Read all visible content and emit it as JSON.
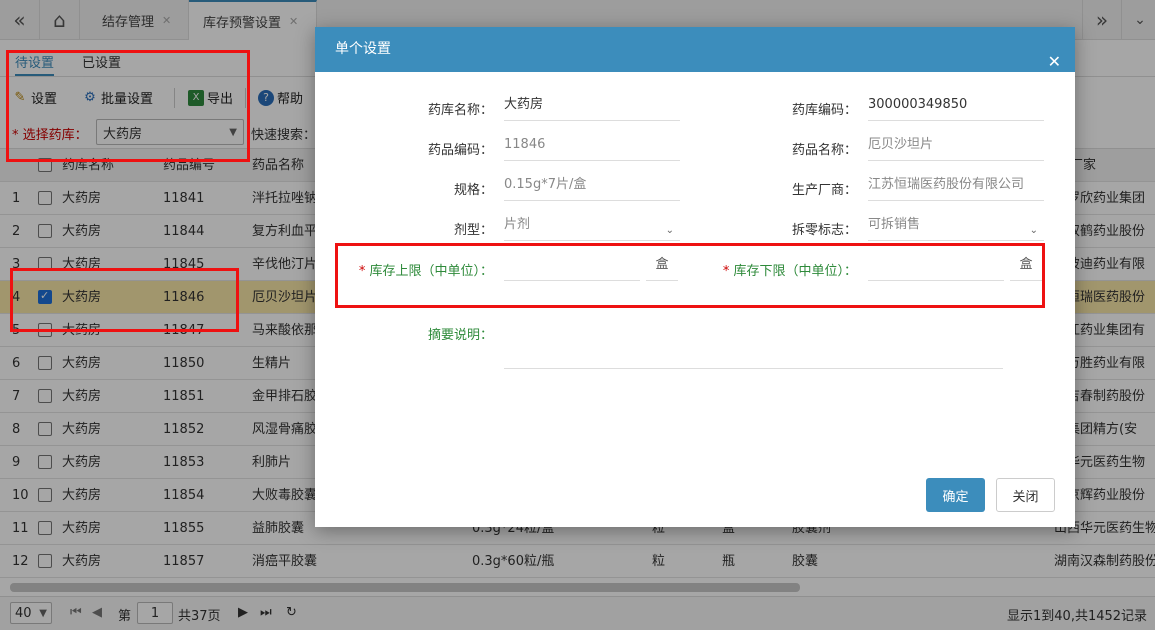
{
  "topbar": {
    "tabs": [
      {
        "label": "结存管理"
      },
      {
        "label": "库存预警设置"
      }
    ]
  },
  "subtabs": [
    "待设置",
    "已设置"
  ],
  "toolbar": {
    "set": "设置",
    "batch": "批量设置",
    "export": "导出",
    "help": "帮助"
  },
  "filter": {
    "warehouse_label": "选择药库：",
    "warehouse_value": "大药房",
    "quick_search_label": "快速搜索："
  },
  "table": {
    "headers": [
      "药库名称",
      "药品编号",
      "药品名称",
      "厂家"
    ],
    "rows": [
      {
        "n": "1",
        "wh": "大药房",
        "code": "11841",
        "name": "泮托拉唑钠",
        "spec": "",
        "u1": "",
        "u2": "",
        "form": "",
        "maker": "东罗欣药业集团"
      },
      {
        "n": "2",
        "wh": "大药房",
        "code": "11844",
        "name": "复方利血平",
        "spec": "",
        "u1": "",
        "u2": "",
        "form": "",
        "maker": "南双鹤药业股份"
      },
      {
        "n": "3",
        "wh": "大药房",
        "code": "11845",
        "name": "辛伐他汀片",
        "spec": "",
        "u1": "",
        "u2": "",
        "form": "",
        "maker": "东彼迪药业有限"
      },
      {
        "n": "4",
        "wh": "大药房",
        "code": "11846",
        "name": "厄贝沙坦片",
        "spec": "",
        "u1": "",
        "u2": "",
        "form": "",
        "maker": "苏恒瑞医药股份"
      },
      {
        "n": "5",
        "wh": "大药房",
        "code": "11847",
        "name": "马来酸依那",
        "spec": "",
        "u1": "",
        "u2": "",
        "form": "",
        "maker": "华江药业集团有"
      },
      {
        "n": "6",
        "wh": "大药房",
        "code": "11850",
        "name": "生精片",
        "spec": "",
        "u1": "",
        "u2": "",
        "form": "",
        "maker": "州万胜药业有限"
      },
      {
        "n": "7",
        "wh": "大药房",
        "code": "11851",
        "name": "金甲排石胶",
        "spec": "",
        "u1": "",
        "u2": "",
        "form": "",
        "maker": "东吉春制药股份"
      },
      {
        "n": "8",
        "wh": "大药房",
        "code": "11852",
        "name": "风湿骨痛胶",
        "spec": "",
        "u1": "",
        "u2": "",
        "form": "",
        "maker": "药集团精方(安"
      },
      {
        "n": "9",
        "wh": "大药房",
        "code": "11853",
        "name": "利肺片",
        "spec": "",
        "u1": "",
        "u2": "",
        "form": "",
        "maker": "西华元医药生物"
      },
      {
        "n": "10",
        "wh": "大药房",
        "code": "11854",
        "name": "大败毒胶囊",
        "spec": "",
        "u1": "",
        "u2": "",
        "form": "",
        "maker": "东京辉药业股份"
      },
      {
        "n": "11",
        "wh": "大药房",
        "code": "11855",
        "name": "益肺胶囊",
        "spec": "0.3g*24粒/盒",
        "u1": "粒",
        "u2": "盒",
        "form": "胶囊剂",
        "maker": "山西华元医药生物"
      },
      {
        "n": "12",
        "wh": "大药房",
        "code": "11857",
        "name": "消癌平胶囊",
        "spec": "0.3g*60粒/瓶",
        "u1": "粒",
        "u2": "瓶",
        "form": "胶囊",
        "maker": "湖南汉森制药股份"
      }
    ]
  },
  "pager": {
    "page_size": "40",
    "page_label": "第",
    "page_value": "1",
    "total_pages": "共37页",
    "summary": "显示1到40,共1452记录"
  },
  "modal": {
    "title": "单个设置",
    "warehouse_name_label": "药库名称：",
    "warehouse_name": "大药房",
    "warehouse_code_label": "药库编码：",
    "warehouse_code": "300000349850",
    "drug_code_label": "药品编码：",
    "drug_code": "11846",
    "drug_name_label": "药品名称：",
    "drug_name": "厄贝沙坦片",
    "spec_label": "规格：",
    "spec": "0.15g*7片/盒",
    "maker_label": "生产厂商：",
    "maker": "江苏恒瑞医药股份有限公司",
    "form_label": "剂型：",
    "form": "片剂",
    "split_label": "拆零标志：",
    "split": "可拆销售",
    "upper_label": "库存上限（中单位）：",
    "upper_unit": "盒",
    "lower_label": "库存下限（中单位）：",
    "lower_unit": "盒",
    "note_label": "摘要说明：",
    "confirm": "确定",
    "close": "关闭"
  }
}
